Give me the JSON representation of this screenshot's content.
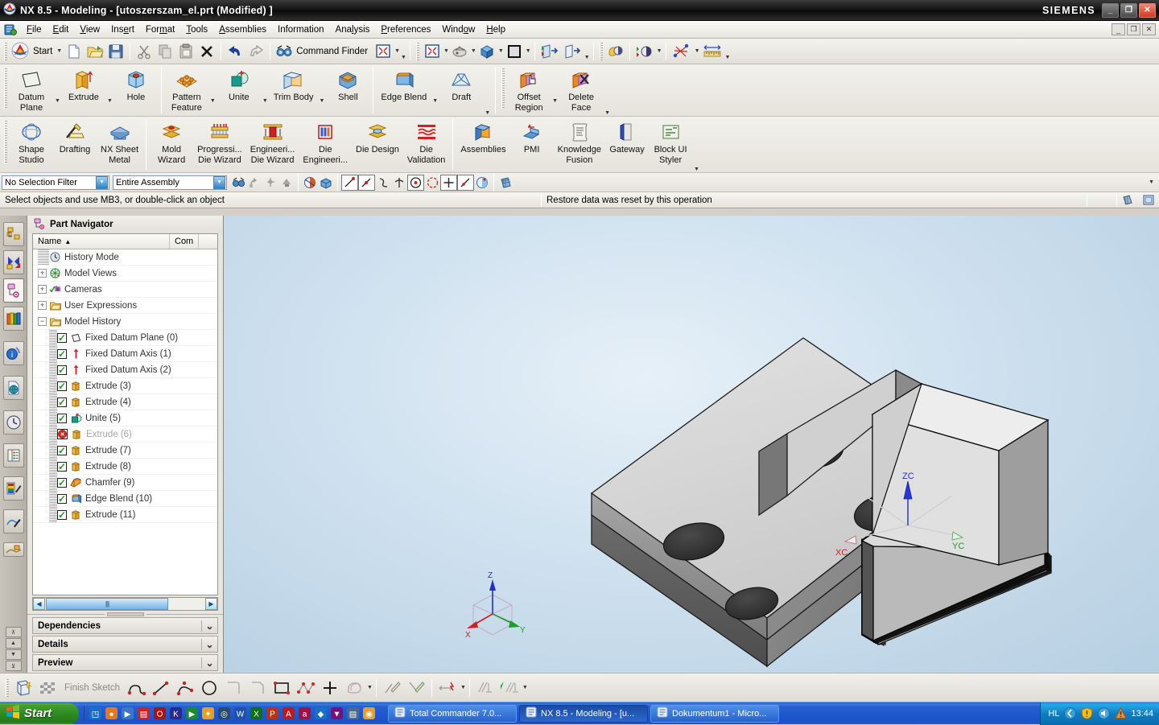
{
  "window": {
    "title": "NX 8.5 - Modeling - [utoszerszam_el.prt (Modified) ]",
    "brand": "SIEMENS",
    "minimize": "_",
    "maximize": "❐",
    "close": "✕",
    "mdi_minimize": "_",
    "mdi_restore": "❐",
    "mdi_close": "✕"
  },
  "menu": {
    "items": [
      {
        "label": "File"
      },
      {
        "label": "Edit"
      },
      {
        "label": "View"
      },
      {
        "label": "Insert"
      },
      {
        "label": "Format"
      },
      {
        "label": "Tools"
      },
      {
        "label": "Assemblies"
      },
      {
        "label": "Information"
      },
      {
        "label": "Analysis"
      },
      {
        "label": "Preferences"
      },
      {
        "label": "Window"
      },
      {
        "label": "Help"
      }
    ]
  },
  "standard_toolbar": {
    "start_label": "Start",
    "command_finder_label": "Command Finder",
    "buttons": [
      {
        "name": "new-file",
        "icon": "new-document-icon"
      },
      {
        "name": "open-file",
        "icon": "open-folder-icon"
      },
      {
        "name": "save-file",
        "icon": "floppy-disk-icon"
      },
      {
        "name": "cut",
        "icon": "scissors-icon"
      },
      {
        "name": "copy",
        "icon": "copy-icon"
      },
      {
        "name": "paste",
        "icon": "clipboard-icon"
      },
      {
        "name": "delete",
        "icon": "x-delete-icon"
      },
      {
        "name": "undo",
        "icon": "undo-arrow-icon"
      },
      {
        "name": "redo",
        "icon": "redo-arrow-icon"
      }
    ]
  },
  "view_toolbar": {
    "buttons": [
      {
        "name": "fit-view",
        "icon": "fit-window-icon"
      },
      {
        "name": "zoom-fit",
        "icon": "fit-window-icon"
      },
      {
        "name": "pan-rotate",
        "icon": "mouse-rotate-icon"
      },
      {
        "name": "orient-view",
        "icon": "blue-cube-icon"
      },
      {
        "name": "background-color",
        "icon": "gray-square-icon"
      },
      {
        "name": "show-hide",
        "icon": "show-hide-icon"
      },
      {
        "name": "hide-object",
        "icon": "hide-object-icon"
      },
      {
        "name": "edit-object-display",
        "icon": "palette-icon"
      },
      {
        "name": "section-view",
        "icon": "section-icon"
      },
      {
        "name": "measure-distance",
        "icon": "measure-icon"
      },
      {
        "name": "ruler",
        "icon": "ruler-icon"
      }
    ]
  },
  "ribbon_feature": {
    "items": [
      {
        "label": "Datum\nPlane",
        "line1": "Datum",
        "line2": "Plane",
        "icon": "datum-plane-icon",
        "has_caret": true
      },
      {
        "label": "Extrude",
        "line1": "Extrude",
        "line2": "",
        "icon": "extrude-icon",
        "has_caret": true
      },
      {
        "label": "Hole",
        "line1": "Hole",
        "line2": "",
        "icon": "hole-icon",
        "has_caret": false
      },
      {
        "label": "Pattern Feature",
        "line1": "Pattern",
        "line2": "Feature",
        "icon": "pattern-feature-icon",
        "has_caret": true
      },
      {
        "label": "Unite",
        "line1": "Unite",
        "line2": "",
        "icon": "unite-icon",
        "has_caret": true
      },
      {
        "label": "Trim Body",
        "line1": "Trim Body",
        "line2": "",
        "icon": "trim-body-icon",
        "has_caret": true
      },
      {
        "label": "Shell",
        "line1": "Shell",
        "line2": "",
        "icon": "shell-icon",
        "has_caret": false
      },
      {
        "label": "Edge Blend",
        "line1": "Edge Blend",
        "line2": "",
        "icon": "edge-blend-icon",
        "has_caret": true
      },
      {
        "label": "Draft",
        "line1": "Draft",
        "line2": "",
        "icon": "draft-icon",
        "has_caret": false
      },
      {
        "label": "Offset Region",
        "line1": "Offset",
        "line2": "Region",
        "icon": "offset-region-icon",
        "has_caret": true
      },
      {
        "label": "Delete Face",
        "line1": "Delete",
        "line2": "Face",
        "icon": "delete-face-icon",
        "has_caret": true
      }
    ]
  },
  "ribbon_apps": {
    "items": [
      {
        "line1": "Shape",
        "line2": "Studio",
        "icon": "shape-studio-icon"
      },
      {
        "line1": "Drafting",
        "line2": "",
        "icon": "drafting-icon"
      },
      {
        "line1": "NX Sheet",
        "line2": "Metal",
        "icon": "sheet-metal-icon"
      },
      {
        "line1": "Mold",
        "line2": "Wizard",
        "icon": "mold-wizard-icon"
      },
      {
        "line1": "Progressi...",
        "line2": "Die Wizard",
        "icon": "progressive-die-wizard-icon"
      },
      {
        "line1": "Engineeri...",
        "line2": "Die Wizard",
        "icon": "engineering-die-wizard-icon"
      },
      {
        "line1": "Die",
        "line2": "Engineeri...",
        "icon": "die-engineering-icon"
      },
      {
        "line1": "Die Design",
        "line2": "",
        "icon": "die-design-icon"
      },
      {
        "line1": "Die",
        "line2": "Validation",
        "icon": "die-validation-icon"
      },
      {
        "line1": "Assemblies",
        "line2": "",
        "icon": "assemblies-icon"
      },
      {
        "line1": "PMI",
        "line2": "",
        "icon": "pmi-icon"
      },
      {
        "line1": "Knowledge",
        "line2": "Fusion",
        "icon": "knowledge-fusion-icon"
      },
      {
        "line1": "Gateway",
        "line2": "",
        "icon": "gateway-icon"
      },
      {
        "line1": "Block UI",
        "line2": "Styler",
        "icon": "block-ui-styler-icon"
      }
    ]
  },
  "selection_bar": {
    "filter_value": "No Selection Filter",
    "scope_value": "Entire Assembly",
    "snap_icons": [
      {
        "name": "find-object-icon"
      },
      {
        "name": "up-one-level-icon"
      },
      {
        "name": "select-general-icon"
      },
      {
        "name": "select-feature-icon"
      },
      {
        "name": "snap-point-icon"
      },
      {
        "name": "face-snap-icon"
      },
      {
        "name": "end-point-icon"
      },
      {
        "name": "midpoint-icon"
      },
      {
        "name": "control-point-icon"
      },
      {
        "name": "intersection-icon"
      },
      {
        "name": "arc-center-icon"
      },
      {
        "name": "quadrant-point-icon"
      },
      {
        "name": "existing-point-icon"
      },
      {
        "name": "point-on-curve-icon"
      },
      {
        "name": "point-on-face-icon"
      },
      {
        "name": "snap-grid-icon"
      }
    ]
  },
  "status_bar": {
    "prompt": "Select objects and use MB3, or double-click an object",
    "message": "Restore data was reset by this operation"
  },
  "resource_bar": {
    "items": [
      {
        "name": "assembly-navigator",
        "icon": "assembly-navigator-icon"
      },
      {
        "name": "constraint-navigator",
        "icon": "constraint-navigator-icon"
      },
      {
        "name": "part-navigator",
        "icon": "part-navigator-icon",
        "active": true
      },
      {
        "name": "reuse-library",
        "icon": "reuse-library-icon"
      },
      {
        "name": "hd3d-tools",
        "icon": "hd3d-tools-icon"
      },
      {
        "name": "web-browser",
        "icon": "web-browser-icon"
      },
      {
        "name": "history",
        "icon": "history-clock-icon"
      },
      {
        "name": "process-studio",
        "icon": "process-studio-icon"
      },
      {
        "name": "roles",
        "icon": "roles-palette-icon"
      },
      {
        "name": "system-materials",
        "icon": "system-materials-icon"
      },
      {
        "name": "system-scenes",
        "icon": "system-scenes-icon"
      }
    ]
  },
  "part_navigator": {
    "title": "Part Navigator",
    "columns": [
      {
        "label": "Name",
        "sort": "▲"
      },
      {
        "label": "Com"
      }
    ],
    "rows": [
      {
        "label": "History Mode",
        "depth": 0,
        "marker": "none",
        "expander": "none",
        "icon": "clock-icon",
        "state": "normal"
      },
      {
        "label": "Model Views",
        "depth": 0,
        "marker": "none",
        "expander": "plus",
        "icon": "model-views-icon",
        "state": "normal"
      },
      {
        "label": "Cameras",
        "depth": 0,
        "marker": "none",
        "expander": "plus",
        "icon": "cameras-icon",
        "state": "normal"
      },
      {
        "label": "User Expressions",
        "depth": 0,
        "marker": "none",
        "expander": "plus",
        "icon": "folder-icon",
        "state": "normal"
      },
      {
        "label": "Model History",
        "depth": 0,
        "marker": "none",
        "expander": "minus",
        "icon": "folder-icon",
        "state": "normal"
      },
      {
        "label": "Fixed Datum Plane (0)",
        "depth": 1,
        "marker": "check",
        "expander": "none",
        "icon": "datum-plane-small-icon",
        "state": "normal"
      },
      {
        "label": "Fixed Datum Axis (1)",
        "depth": 1,
        "marker": "check",
        "expander": "none",
        "icon": "datum-axis-icon",
        "state": "normal"
      },
      {
        "label": "Fixed Datum Axis (2)",
        "depth": 1,
        "marker": "check",
        "expander": "none",
        "icon": "datum-axis-icon",
        "state": "normal"
      },
      {
        "label": "Extrude (3)",
        "depth": 1,
        "marker": "check",
        "expander": "none",
        "icon": "extrude-small-icon",
        "state": "normal"
      },
      {
        "label": "Extrude (4)",
        "depth": 1,
        "marker": "check",
        "expander": "none",
        "icon": "extrude-small-icon",
        "state": "normal"
      },
      {
        "label": "Unite (5)",
        "depth": 1,
        "marker": "check",
        "expander": "none",
        "icon": "unite-small-icon",
        "state": "normal"
      },
      {
        "label": "Extrude (6)",
        "depth": 1,
        "marker": "error",
        "expander": "none",
        "icon": "extrude-small-icon",
        "state": "suppressed"
      },
      {
        "label": "Extrude (7)",
        "depth": 1,
        "marker": "check",
        "expander": "none",
        "icon": "extrude-small-icon",
        "state": "normal"
      },
      {
        "label": "Extrude (8)",
        "depth": 1,
        "marker": "check",
        "expander": "none",
        "icon": "extrude-small-icon",
        "state": "normal"
      },
      {
        "label": "Chamfer (9)",
        "depth": 1,
        "marker": "check",
        "expander": "none",
        "icon": "chamfer-icon",
        "state": "normal"
      },
      {
        "label": "Edge Blend (10)",
        "depth": 1,
        "marker": "check",
        "expander": "none",
        "icon": "edge-blend-small-icon",
        "state": "normal"
      },
      {
        "label": "Extrude (11)",
        "depth": 1,
        "marker": "check",
        "expander": "none",
        "icon": "extrude-small-icon",
        "state": "normal"
      }
    ],
    "panels": [
      {
        "label": "Dependencies",
        "chevron": "⌄"
      },
      {
        "label": "Details",
        "chevron": "⌄"
      },
      {
        "label": "Preview",
        "chevron": "⌄"
      }
    ]
  },
  "viewport": {
    "wcs_labels": {
      "x": "XC",
      "y": "YC",
      "z": "ZC"
    },
    "triad_labels": {
      "x": "X",
      "y": "Y",
      "z": "Z"
    },
    "colors": {
      "background_top": "#e6f0f8",
      "background_bottom": "#b6cfe2",
      "face_top": "#d3d3d3",
      "face_front": "#5a5a5a",
      "face_side": "#9a9a9a",
      "edge": "#1c1c1c",
      "axis_x": "#d02020",
      "axis_y": "#1aa02a",
      "axis_z": "#2030d0"
    }
  },
  "sketch_toolbar": {
    "finish_label": "Finish Sketch",
    "buttons": [
      {
        "name": "sketch-in-task-environment",
        "icon": "sketch-task-icon"
      },
      {
        "name": "finish-sketch",
        "icon": "checkered-flag-icon"
      },
      {
        "name": "profile",
        "icon": "profile-curve-icon"
      },
      {
        "name": "line",
        "icon": "line-icon"
      },
      {
        "name": "arc",
        "icon": "arc-icon"
      },
      {
        "name": "circle",
        "icon": "circle-icon"
      },
      {
        "name": "fillet",
        "icon": "fillet-icon"
      },
      {
        "name": "chamfer",
        "icon": "chamfer-curve-icon"
      },
      {
        "name": "rectangle",
        "icon": "rectangle-icon"
      },
      {
        "name": "studio-spline",
        "icon": "spline-icon"
      },
      {
        "name": "point",
        "icon": "point-plus-icon"
      },
      {
        "name": "offset-curve",
        "icon": "offset-curve-icon"
      },
      {
        "name": "quick-trim",
        "icon": "quick-trim-icon"
      },
      {
        "name": "quick-extend",
        "icon": "quick-extend-icon"
      },
      {
        "name": "rapid-dimension",
        "icon": "rapid-dimension-icon"
      },
      {
        "name": "geometric-constraints",
        "icon": "geometric-constraint-icon"
      },
      {
        "name": "show-constraints",
        "icon": "show-constraints-icon"
      }
    ]
  },
  "taskbar": {
    "start_label": "Start",
    "quick_launch": [
      {
        "name": "nx-quick",
        "glyph": "◳",
        "color": "#1a6fc4"
      },
      {
        "name": "firefox",
        "glyph": "●",
        "color": "#e8761b"
      },
      {
        "name": "media-player",
        "glyph": "▶",
        "color": "#3a76c4"
      },
      {
        "name": "total-commander",
        "glyph": "▤",
        "color": "#d22020"
      },
      {
        "name": "opera",
        "glyph": "O",
        "color": "#b01010"
      },
      {
        "name": "kmplayer",
        "glyph": "K",
        "color": "#2a2a8a"
      },
      {
        "name": "gom-player",
        "glyph": "▶",
        "color": "#1a8a2a"
      },
      {
        "name": "comet",
        "glyph": "✦",
        "color": "#e8a020"
      },
      {
        "name": "search",
        "glyph": "◎",
        "color": "#2a4a6a"
      },
      {
        "name": "word",
        "glyph": "W",
        "color": "#2050a8"
      },
      {
        "name": "excel",
        "glyph": "X",
        "color": "#107010"
      },
      {
        "name": "powerpoint",
        "glyph": "P",
        "color": "#c03010"
      },
      {
        "name": "acrobat",
        "glyph": "A",
        "color": "#c01818"
      },
      {
        "name": "access",
        "glyph": "a",
        "color": "#a01040"
      },
      {
        "name": "nx",
        "glyph": "◆",
        "color": "#1a6fc4"
      },
      {
        "name": "winrar",
        "glyph": "▼",
        "color": "#7a1080"
      },
      {
        "name": "notepad",
        "glyph": "▤",
        "color": "#4a6a8a"
      },
      {
        "name": "avg",
        "glyph": "◉",
        "color": "#e8a020"
      }
    ],
    "tasks": [
      {
        "label": "Total Commander 7.0...",
        "active": false,
        "icon": "total-commander-icon"
      },
      {
        "label": "NX 8.5 - Modeling - [u...",
        "active": true,
        "icon": "nx-icon"
      },
      {
        "label": "Dokumentum1 - Micro...",
        "active": false,
        "icon": "word-icon"
      }
    ],
    "tray": {
      "language": "HL",
      "clock": "13:44",
      "icons": [
        {
          "name": "network-icon",
          "glyph": "‹",
          "color": "#9fd8f0"
        },
        {
          "name": "shield-icon",
          "glyph": "!",
          "color": "#f0c020"
        },
        {
          "name": "volume-icon",
          "glyph": "◕",
          "color": "#60b8e8"
        },
        {
          "name": "warning-icon",
          "glyph": "▲",
          "color": "#e8903a"
        }
      ]
    }
  }
}
